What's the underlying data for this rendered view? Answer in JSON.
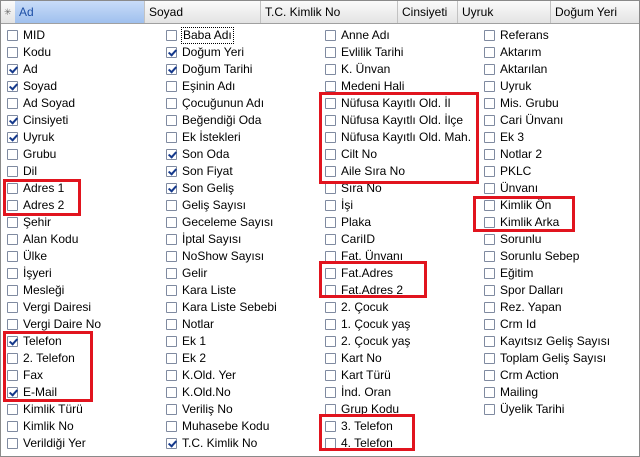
{
  "header": {
    "icon": "asterisk-icon",
    "columns": [
      "Ad",
      "Soyad",
      "T.C. Kimlik No",
      "Cinsiyeti",
      "Uyruk",
      "Doğum Yeri"
    ],
    "selected_column": "Ad"
  },
  "colors": {
    "checkbox_border": "#7f8aa0",
    "check_mark": "#15398c",
    "highlight": "#e1141e",
    "header_selected": "#9fc0ee"
  },
  "columns": [
    {
      "items": [
        {
          "label": "MID",
          "checked": false
        },
        {
          "label": "Kodu",
          "checked": false
        },
        {
          "label": "Ad",
          "checked": true
        },
        {
          "label": "Soyad",
          "checked": true
        },
        {
          "label": "Ad Soyad",
          "checked": false
        },
        {
          "label": "Cinsiyeti",
          "checked": true
        },
        {
          "label": "Uyruk",
          "checked": true
        },
        {
          "label": "Grubu",
          "checked": false
        },
        {
          "label": "Dil",
          "checked": false
        },
        {
          "label": "Adres 1",
          "checked": false
        },
        {
          "label": "Adres 2",
          "checked": false
        },
        {
          "label": "Şehir",
          "checked": false
        },
        {
          "label": "Alan Kodu",
          "checked": false
        },
        {
          "label": "Ülke",
          "checked": false
        },
        {
          "label": "İşyeri",
          "checked": false
        },
        {
          "label": "Mesleği",
          "checked": false
        },
        {
          "label": "Vergi Dairesi",
          "checked": false
        },
        {
          "label": "Vergi Daire No",
          "checked": false
        },
        {
          "label": "Telefon",
          "checked": true
        },
        {
          "label": "2. Telefon",
          "checked": false
        },
        {
          "label": "Fax",
          "checked": false
        },
        {
          "label": "E-Mail",
          "checked": true
        },
        {
          "label": "Kimlik Türü",
          "checked": false
        },
        {
          "label": "Kimlik No",
          "checked": false
        },
        {
          "label": "Verildiği Yer",
          "checked": false
        }
      ]
    },
    {
      "items": [
        {
          "label": "Baba Adı",
          "checked": false,
          "focused": true
        },
        {
          "label": "Doğum Yeri",
          "checked": true
        },
        {
          "label": "Doğum Tarihi",
          "checked": true
        },
        {
          "label": "Eşinin Adı",
          "checked": false
        },
        {
          "label": "Çocuğunun Adı",
          "checked": false
        },
        {
          "label": "Beğendiği Oda",
          "checked": false
        },
        {
          "label": "Ek İstekleri",
          "checked": false
        },
        {
          "label": "Son Oda",
          "checked": true
        },
        {
          "label": "Son Fiyat",
          "checked": true
        },
        {
          "label": "Son Geliş",
          "checked": true
        },
        {
          "label": "Geliş Sayısı",
          "checked": false
        },
        {
          "label": "Geceleme Sayısı",
          "checked": false
        },
        {
          "label": "İptal Sayısı",
          "checked": false
        },
        {
          "label": "NoShow Sayısı",
          "checked": false
        },
        {
          "label": "Gelir",
          "checked": false
        },
        {
          "label": "Kara Liste",
          "checked": false
        },
        {
          "label": "Kara Liste Sebebi",
          "checked": false
        },
        {
          "label": "Notlar",
          "checked": false
        },
        {
          "label": "Ek 1",
          "checked": false
        },
        {
          "label": "Ek 2",
          "checked": false
        },
        {
          "label": "K.Old. Yer",
          "checked": false
        },
        {
          "label": "K.Old.No",
          "checked": false
        },
        {
          "label": "Veriliş No",
          "checked": false
        },
        {
          "label": "Muhasebe Kodu",
          "checked": false
        },
        {
          "label": "T.C. Kimlik No",
          "checked": true
        }
      ]
    },
    {
      "items": [
        {
          "label": "Anne Adı",
          "checked": false
        },
        {
          "label": "Evlilik Tarihi",
          "checked": false
        },
        {
          "label": "K. Ünvan",
          "checked": false
        },
        {
          "label": "Medeni Hali",
          "checked": false
        },
        {
          "label": "Nüfusa Kayıtlı Old. İl",
          "checked": false
        },
        {
          "label": "Nüfusa Kayıtlı Old. İlçe",
          "checked": false
        },
        {
          "label": "Nüfusa Kayıtlı Old. Mah.",
          "checked": false
        },
        {
          "label": "Cilt No",
          "checked": false
        },
        {
          "label": "Aile Sıra No",
          "checked": false
        },
        {
          "label": "Sıra No",
          "checked": false
        },
        {
          "label": "İşi",
          "checked": false
        },
        {
          "label": "Plaka",
          "checked": false
        },
        {
          "label": "CariID",
          "checked": false
        },
        {
          "label": "Fat. Ünvanı",
          "checked": false
        },
        {
          "label": "Fat.Adres",
          "checked": false
        },
        {
          "label": "Fat.Adres 2",
          "checked": false
        },
        {
          "label": "2. Çocuk",
          "checked": false
        },
        {
          "label": "1. Çocuk yaş",
          "checked": false
        },
        {
          "label": "2. Çocuk yaş",
          "checked": false
        },
        {
          "label": "Kart No",
          "checked": false
        },
        {
          "label": "Kart Türü",
          "checked": false
        },
        {
          "label": "İnd. Oran",
          "checked": false
        },
        {
          "label": "Grup Kodu",
          "checked": false
        },
        {
          "label": "3. Telefon",
          "checked": false
        },
        {
          "label": "4. Telefon",
          "checked": false
        }
      ]
    },
    {
      "items": [
        {
          "label": "Referans",
          "checked": false
        },
        {
          "label": "Aktarım",
          "checked": false
        },
        {
          "label": "Aktarılan",
          "checked": false
        },
        {
          "label": "Uyruk",
          "checked": false
        },
        {
          "label": "Mis. Grubu",
          "checked": false
        },
        {
          "label": "Cari Ünvanı",
          "checked": false
        },
        {
          "label": "Ek 3",
          "checked": false
        },
        {
          "label": "Notlar 2",
          "checked": false
        },
        {
          "label": "PKLC",
          "checked": false
        },
        {
          "label": "Ünvanı",
          "checked": false
        },
        {
          "label": "Kimlik Ön",
          "checked": false
        },
        {
          "label": "Kimlik Arka",
          "checked": false
        },
        {
          "label": "Sorunlu",
          "checked": false
        },
        {
          "label": "Sorunlu Sebep",
          "checked": false
        },
        {
          "label": "Eğitim",
          "checked": false
        },
        {
          "label": "Spor Dalları",
          "checked": false
        },
        {
          "label": "Rez. Yapan",
          "checked": false
        },
        {
          "label": "Crm Id",
          "checked": false
        },
        {
          "label": "Kayıtsız Geliş Sayısı",
          "checked": false
        },
        {
          "label": "Toplam Geliş Sayısı",
          "checked": false
        },
        {
          "label": "Crm Action",
          "checked": false
        },
        {
          "label": "Mailing",
          "checked": false
        },
        {
          "label": "Üyelik Tarihi",
          "checked": false
        }
      ]
    }
  ]
}
